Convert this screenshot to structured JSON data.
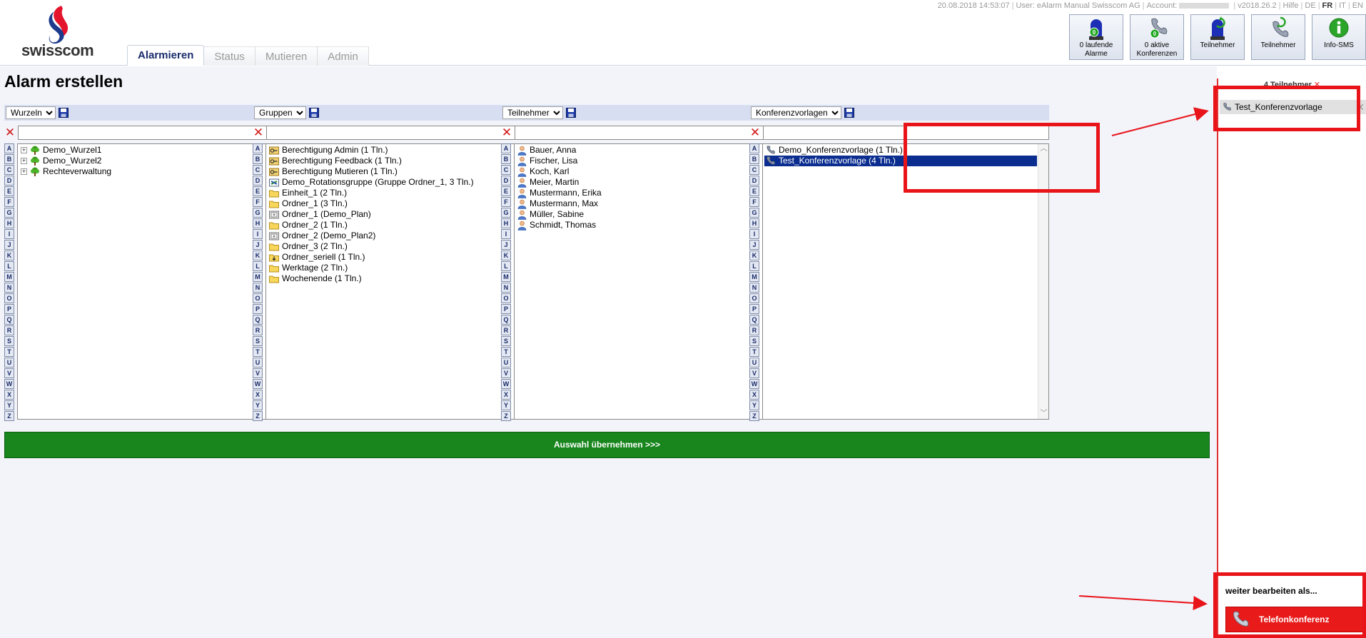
{
  "brand": {
    "name": "swisscom"
  },
  "topbar": {
    "datetime": "20.08.2018 14:53:07",
    "user": "User: eAlarm Manual Swisscom AG",
    "account_label": "Account:",
    "version": "v2018.26.2",
    "help": "Hilfe",
    "languages": [
      "DE",
      "FR",
      "IT",
      "EN"
    ],
    "active_language": "FR"
  },
  "tabs": [
    {
      "label": "Alarmieren",
      "active": true
    },
    {
      "label": "Status",
      "active": false
    },
    {
      "label": "Mutieren",
      "active": false
    },
    {
      "label": "Admin",
      "active": false
    }
  ],
  "top_buttons": [
    {
      "line1": "0 laufende",
      "line2": "Alarme",
      "badge": "0",
      "icon": "siren-icon"
    },
    {
      "line1": "0 aktive",
      "line2": "Konferenzen",
      "badge": "0",
      "icon": "conference-phone-icon"
    },
    {
      "line1": "Teilnehmer",
      "line2": "",
      "icon": "siren-refresh-icon"
    },
    {
      "line1": "Teilnehmer",
      "line2": "",
      "icon": "phone-refresh-icon"
    },
    {
      "line1": "Info-SMS",
      "line2": "",
      "icon": "info-icon"
    }
  ],
  "page_title": "Alarm erstellen",
  "letters": [
    "A",
    "B",
    "C",
    "D",
    "E",
    "F",
    "G",
    "H",
    "I",
    "J",
    "K",
    "L",
    "M",
    "N",
    "O",
    "P",
    "Q",
    "R",
    "S",
    "T",
    "U",
    "V",
    "W",
    "X",
    "Y",
    "Z"
  ],
  "columns": [
    {
      "select_value": "Wurzeln",
      "items": [
        {
          "label": "Demo_Wurzel1",
          "icon": "tree-icon",
          "expandable": true
        },
        {
          "label": "Demo_Wurzel2",
          "icon": "tree-icon",
          "expandable": true
        },
        {
          "label": "Rechteverwaltung",
          "icon": "tree-icon",
          "expandable": true
        }
      ]
    },
    {
      "select_value": "Gruppen",
      "items": [
        {
          "label": "Berechtigung Admin (1 Tln.)",
          "icon": "key-icon"
        },
        {
          "label": "Berechtigung Feedback (1 Tln.)",
          "icon": "key-icon"
        },
        {
          "label": "Berechtigung Mutieren (1 Tln.)",
          "icon": "key-icon"
        },
        {
          "label": "Demo_Rotationsgruppe (Gruppe Ordner_1, 3 Tln.)",
          "icon": "rotation-icon"
        },
        {
          "label": "Einheit_1 (2 Tln.)",
          "icon": "folder-icon"
        },
        {
          "label": "Ordner_1 (3 Tln.)",
          "icon": "folder-icon"
        },
        {
          "label": "Ordner_1 (Demo_Plan)",
          "icon": "calendar-icon"
        },
        {
          "label": "Ordner_2 (1 Tln.)",
          "icon": "folder-icon"
        },
        {
          "label": "Ordner_2 (Demo_Plan2)",
          "icon": "calendar-icon"
        },
        {
          "label": "Ordner_3 (2 Tln.)",
          "icon": "folder-icon"
        },
        {
          "label": "Ordner_seriell (1 Tln.)",
          "icon": "serial-folder-icon"
        },
        {
          "label": "Werktage (2 Tln.)",
          "icon": "folder-icon"
        },
        {
          "label": "Wochenende (1 Tln.)",
          "icon": "folder-icon"
        }
      ]
    },
    {
      "select_value": "Teilnehmer",
      "items": [
        {
          "label": "Bauer, Anna",
          "icon": "person-icon"
        },
        {
          "label": "Fischer, Lisa",
          "icon": "person-icon"
        },
        {
          "label": "Koch, Karl",
          "icon": "person-icon"
        },
        {
          "label": "Meier, Martin",
          "icon": "person-icon"
        },
        {
          "label": "Mustermann, Erika",
          "icon": "person-icon"
        },
        {
          "label": "Mustermann, Max",
          "icon": "person-icon"
        },
        {
          "label": "Müller, Sabine",
          "icon": "person-icon"
        },
        {
          "label": "Schmidt, Thomas",
          "icon": "person-icon"
        }
      ]
    },
    {
      "select_value": "Konferenzvorlagen",
      "items": [
        {
          "label": "Demo_Konferenzvorlage (1 Tln.)",
          "icon": "phone-icon"
        },
        {
          "label": "Test_Konferenzvorlage (4 Tln.)",
          "icon": "phone-icon",
          "selected": true
        }
      ]
    }
  ],
  "take_over_button": "Auswahl übernehmen >>>",
  "right_panel": {
    "header": "4 Teilnehmer",
    "header_close": "✕",
    "selected_item": "Test_Konferenzvorlage",
    "remove_symbol": "✕",
    "continue_label": "weiter bearbeiten als...",
    "conference_button": "Telefonkonferenz"
  },
  "colors": {
    "accent_green": "#18861d",
    "conference_red": "#e81a1a",
    "selection_blue": "#0a2d8f",
    "annotation_red": "#e8141a",
    "tab_active": "#1a2d6b"
  }
}
